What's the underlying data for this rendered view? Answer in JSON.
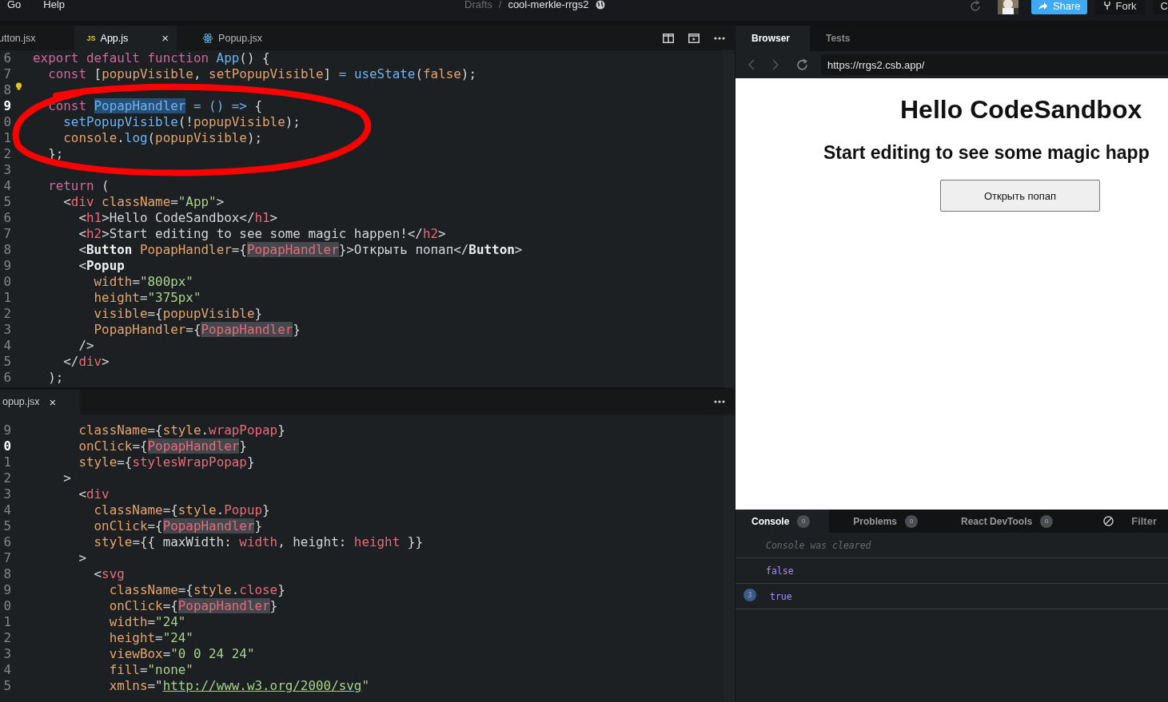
{
  "menu": [
    "Go",
    "Help"
  ],
  "breadcrumb": {
    "folder": "Drafts",
    "separator": "/",
    "sandbox": "cool-merkle-rrgs2"
  },
  "header_actions": {
    "share": "Share",
    "fork": "Fork",
    "more": "C"
  },
  "editor_tabs": [
    {
      "label": "utton.jsx",
      "kind": "plain",
      "selected": false
    },
    {
      "label": "App.js",
      "kind": "js",
      "badge": "JS",
      "close": "×",
      "selected": true
    },
    {
      "label": "Popup.jsx",
      "kind": "react",
      "selected": false
    }
  ],
  "top_editor": {
    "lines": [
      {
        "number": "6",
        "current": false,
        "hint": false,
        "tokens": [
          {
            "text": "export default function ",
            "kind": "kw"
          },
          {
            "text": "App",
            "kind": "fn"
          },
          {
            "text": "() {",
            "kind": "p"
          }
        ]
      },
      {
        "number": "7",
        "current": false,
        "hint": false,
        "tokens": [
          {
            "text": "  const ",
            "kind": "kw"
          },
          {
            "text": "[",
            "kind": "p"
          },
          {
            "text": "popupVisible",
            "kind": "var"
          },
          {
            "text": ", ",
            "kind": "p"
          },
          {
            "text": "setPopupVisible",
            "kind": "var"
          },
          {
            "text": "] ",
            "kind": "p"
          },
          {
            "text": "= ",
            "kind": "op"
          },
          {
            "text": "useState",
            "kind": "fn"
          },
          {
            "text": "(",
            "kind": "p"
          },
          {
            "text": "false",
            "kind": "var"
          },
          {
            "text": ");",
            "kind": "p"
          }
        ]
      },
      {
        "number": "8",
        "current": false,
        "hint": true
      },
      {
        "number": "9",
        "current": true,
        "hint": false,
        "tokens": [
          {
            "text": "  const ",
            "kind": "kw"
          },
          {
            "text": "PopapHandler",
            "kind": "sel"
          },
          {
            "text": " = () => ",
            "kind": "op"
          },
          {
            "text": "{",
            "kind": "p"
          }
        ]
      },
      {
        "number": "0",
        "current": false,
        "hint": false,
        "tokens": [
          {
            "text": "    setPopupVisible",
            "kind": "fn"
          },
          {
            "text": "(!",
            "kind": "p"
          },
          {
            "text": "popupVisible",
            "kind": "var"
          },
          {
            "text": ");",
            "kind": "p"
          }
        ]
      },
      {
        "number": "1",
        "current": false,
        "hint": false,
        "tokens": [
          {
            "text": "    console",
            "kind": "var"
          },
          {
            "text": ".",
            "kind": "p"
          },
          {
            "text": "log",
            "kind": "fn"
          },
          {
            "text": "(",
            "kind": "p"
          },
          {
            "text": "popupVisible",
            "kind": "var"
          },
          {
            "text": ");",
            "kind": "p"
          }
        ]
      },
      {
        "number": "2",
        "current": false,
        "hint": false,
        "tokens": [
          {
            "text": "  };",
            "kind": "p"
          }
        ]
      },
      {
        "number": "3",
        "current": false,
        "hint": false
      },
      {
        "number": "4",
        "current": false,
        "hint": false,
        "tokens": [
          {
            "text": "  return ",
            "kind": "kw"
          },
          {
            "text": "(",
            "kind": "p"
          }
        ]
      },
      {
        "number": "5",
        "current": false,
        "hint": false,
        "tokens": [
          {
            "text": "    <",
            "kind": "p"
          },
          {
            "text": "div",
            "kind": "tag"
          },
          {
            "text": " className",
            "kind": "attr"
          },
          {
            "text": "=",
            "kind": "p"
          },
          {
            "text": "\"App\"",
            "kind": "str"
          },
          {
            "text": ">",
            "kind": "p"
          }
        ]
      },
      {
        "number": "6",
        "current": false,
        "hint": false,
        "tokens": [
          {
            "text": "      <",
            "kind": "p"
          },
          {
            "text": "h1",
            "kind": "tag"
          },
          {
            "text": ">Hello CodeSandbox</",
            "kind": "p"
          },
          {
            "text": "h1",
            "kind": "tag"
          },
          {
            "text": ">",
            "kind": "p"
          }
        ]
      },
      {
        "number": "7",
        "current": false,
        "hint": false,
        "tokens": [
          {
            "text": "      <",
            "kind": "p"
          },
          {
            "text": "h2",
            "kind": "tag"
          },
          {
            "text": ">Start editing to see some magic happen!</",
            "kind": "p"
          },
          {
            "text": "h2",
            "kind": "tag"
          },
          {
            "text": ">",
            "kind": "p"
          }
        ]
      },
      {
        "number": "8",
        "current": false,
        "hint": false,
        "tokens": [
          {
            "text": "      <",
            "kind": "p"
          },
          {
            "text": "Button",
            "kind": "comp"
          },
          {
            "text": " PopapHandler",
            "kind": "attr"
          },
          {
            "text": "={",
            "kind": "p"
          },
          {
            "text": "PopapHandler",
            "kind": "hl"
          },
          {
            "text": "}>Открыть попап</",
            "kind": "p"
          },
          {
            "text": "Button",
            "kind": "comp"
          },
          {
            "text": ">",
            "kind": "p"
          }
        ]
      },
      {
        "number": "9",
        "current": false,
        "hint": false,
        "tokens": [
          {
            "text": "      <",
            "kind": "p"
          },
          {
            "text": "Popup",
            "kind": "comp"
          }
        ]
      },
      {
        "number": "0",
        "current": false,
        "hint": false,
        "tokens": [
          {
            "text": "        width",
            "kind": "attr"
          },
          {
            "text": "=",
            "kind": "p"
          },
          {
            "text": "\"800px\"",
            "kind": "str"
          }
        ]
      },
      {
        "number": "1",
        "current": false,
        "hint": false,
        "tokens": [
          {
            "text": "        height",
            "kind": "attr"
          },
          {
            "text": "=",
            "kind": "p"
          },
          {
            "text": "\"375px\"",
            "kind": "str"
          }
        ]
      },
      {
        "number": "2",
        "current": false,
        "hint": false,
        "tokens": [
          {
            "text": "        visible",
            "kind": "attr"
          },
          {
            "text": "={",
            "kind": "p"
          },
          {
            "text": "popupVisible",
            "kind": "var"
          },
          {
            "text": "}",
            "kind": "p"
          }
        ]
      },
      {
        "number": "3",
        "current": false,
        "hint": false,
        "tokens": [
          {
            "text": "        PopapHandler",
            "kind": "attr"
          },
          {
            "text": "={",
            "kind": "p"
          },
          {
            "text": "PopapHandler",
            "kind": "hl"
          },
          {
            "text": "}",
            "kind": "p"
          }
        ]
      },
      {
        "number": "4",
        "current": false,
        "hint": false,
        "tokens": [
          {
            "text": "      />",
            "kind": "p"
          }
        ]
      },
      {
        "number": "5",
        "current": false,
        "hint": false,
        "tokens": [
          {
            "text": "    </",
            "kind": "p"
          },
          {
            "text": "div",
            "kind": "tag"
          },
          {
            "text": ">",
            "kind": "p"
          }
        ]
      },
      {
        "number": "6",
        "current": false,
        "hint": false,
        "tokens": [
          {
            "text": "  );",
            "kind": "p"
          }
        ]
      }
    ]
  },
  "bottom_editor": {
    "tab": {
      "label": "opup.jsx",
      "close": "×"
    },
    "lines": [
      {
        "number": "9",
        "current": false,
        "hint": false,
        "tokens": [
          {
            "text": "      className",
            "kind": "attr"
          },
          {
            "text": "={",
            "kind": "p"
          },
          {
            "text": "style",
            "kind": "var"
          },
          {
            "text": ".",
            "kind": "p"
          },
          {
            "text": "wrapPopap",
            "kind": "tag"
          },
          {
            "text": "}",
            "kind": "p"
          }
        ]
      },
      {
        "number": "0",
        "current": true,
        "hint": false,
        "tokens": [
          {
            "text": "      onClick",
            "kind": "attr"
          },
          {
            "text": "={",
            "kind": "p"
          },
          {
            "text": "PopapHandler",
            "kind": "hl"
          },
          {
            "text": "}",
            "kind": "p"
          }
        ]
      },
      {
        "number": "1",
        "current": false,
        "hint": false,
        "tokens": [
          {
            "text": "      style",
            "kind": "attr"
          },
          {
            "text": "={",
            "kind": "p"
          },
          {
            "text": "stylesWrapPopap",
            "kind": "tag"
          },
          {
            "text": "}",
            "kind": "p"
          }
        ]
      },
      {
        "number": "2",
        "current": false,
        "hint": false,
        "tokens": [
          {
            "text": "    >",
            "kind": "p"
          }
        ]
      },
      {
        "number": "3",
        "current": false,
        "hint": false,
        "tokens": [
          {
            "text": "      <",
            "kind": "p"
          },
          {
            "text": "div",
            "kind": "tag"
          }
        ]
      },
      {
        "number": "4",
        "current": false,
        "hint": false,
        "tokens": [
          {
            "text": "        className",
            "kind": "attr"
          },
          {
            "text": "={",
            "kind": "p"
          },
          {
            "text": "style",
            "kind": "var"
          },
          {
            "text": ".",
            "kind": "p"
          },
          {
            "text": "Popup",
            "kind": "tag"
          },
          {
            "text": "}",
            "kind": "p"
          }
        ]
      },
      {
        "number": "5",
        "current": false,
        "hint": false,
        "tokens": [
          {
            "text": "        onClick",
            "kind": "attr"
          },
          {
            "text": "={",
            "kind": "p"
          },
          {
            "text": "PopapHandler",
            "kind": "hl"
          },
          {
            "text": "}",
            "kind": "p"
          }
        ]
      },
      {
        "number": "6",
        "current": false,
        "hint": false,
        "tokens": [
          {
            "text": "        style",
            "kind": "attr"
          },
          {
            "text": "={{ maxWidth: ",
            "kind": "p"
          },
          {
            "text": "width",
            "kind": "tag"
          },
          {
            "text": ", height: ",
            "kind": "p"
          },
          {
            "text": "height",
            "kind": "tag"
          },
          {
            "text": " }}",
            "kind": "p"
          }
        ]
      },
      {
        "number": "7",
        "current": false,
        "hint": false,
        "tokens": [
          {
            "text": "      >",
            "kind": "p"
          }
        ]
      },
      {
        "number": "8",
        "current": false,
        "hint": false,
        "tokens": [
          {
            "text": "        <",
            "kind": "p"
          },
          {
            "text": "svg",
            "kind": "tag"
          }
        ]
      },
      {
        "number": "9",
        "current": false,
        "hint": false,
        "tokens": [
          {
            "text": "          className",
            "kind": "attr"
          },
          {
            "text": "={",
            "kind": "p"
          },
          {
            "text": "style",
            "kind": "var"
          },
          {
            "text": ".",
            "kind": "p"
          },
          {
            "text": "close",
            "kind": "tag"
          },
          {
            "text": "}",
            "kind": "p"
          }
        ]
      },
      {
        "number": "0",
        "current": false,
        "hint": false,
        "tokens": [
          {
            "text": "          onClick",
            "kind": "attr"
          },
          {
            "text": "={",
            "kind": "p"
          },
          {
            "text": "PopapHandler",
            "kind": "hl"
          },
          {
            "text": "}",
            "kind": "p"
          }
        ]
      },
      {
        "number": "1",
        "current": false,
        "hint": false,
        "tokens": [
          {
            "text": "          width",
            "kind": "attr"
          },
          {
            "text": "=",
            "kind": "p"
          },
          {
            "text": "\"24\"",
            "kind": "str"
          }
        ]
      },
      {
        "number": "2",
        "current": false,
        "hint": false,
        "tokens": [
          {
            "text": "          height",
            "kind": "attr"
          },
          {
            "text": "=",
            "kind": "p"
          },
          {
            "text": "\"24\"",
            "kind": "str"
          }
        ]
      },
      {
        "number": "3",
        "current": false,
        "hint": false,
        "tokens": [
          {
            "text": "          viewBox",
            "kind": "attr"
          },
          {
            "text": "=",
            "kind": "p"
          },
          {
            "text": "\"0 0 24 24\"",
            "kind": "str"
          }
        ]
      },
      {
        "number": "4",
        "current": false,
        "hint": false,
        "tokens": [
          {
            "text": "          fill",
            "kind": "attr"
          },
          {
            "text": "=",
            "kind": "p"
          },
          {
            "text": "\"none\"",
            "kind": "str"
          }
        ]
      },
      {
        "number": "5",
        "current": false,
        "hint": false,
        "tokens": [
          {
            "text": "          xmlns",
            "kind": "attr"
          },
          {
            "text": "=\"",
            "kind": "p"
          },
          {
            "text": "http://www.w3.org/2000/svg",
            "kind": "link"
          },
          {
            "text": "\"",
            "kind": "str"
          }
        ]
      }
    ]
  },
  "preview": {
    "tabs": [
      {
        "label": "Browser",
        "selected": true
      },
      {
        "label": "Tests",
        "selected": false
      }
    ],
    "url": "https://rrgs2.csb.app/",
    "heading": "Hello CodeSandbox",
    "subheading": "Start editing to see some magic happ",
    "button": "Открыть попап"
  },
  "console": {
    "tabs": [
      {
        "label": "Console",
        "count": "0",
        "selected": true
      },
      {
        "label": "Problems",
        "count": "0",
        "selected": false
      },
      {
        "label": "React DevTools",
        "count": "0",
        "selected": false
      }
    ],
    "filter": "Filter",
    "entries": [
      {
        "kind": "info",
        "text": "Console was cleared"
      },
      {
        "kind": "log",
        "text": "false"
      },
      {
        "kind": "log",
        "text": "true",
        "repeat": "3"
      }
    ]
  }
}
